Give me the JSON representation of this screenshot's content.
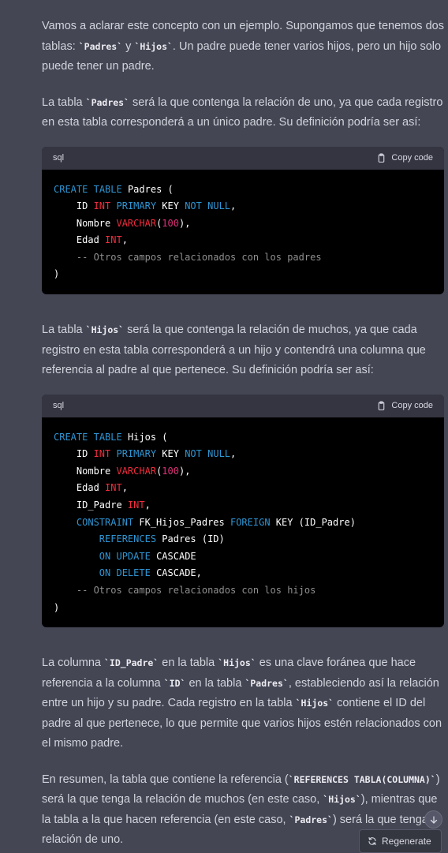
{
  "paragraphs": {
    "p1": [
      "Vamos a aclarar este concepto con un ejemplo. Supongamos que tenemos dos tablas: ",
      "`Padres`",
      " y ",
      "`Hijos`",
      ". Un padre puede tener varios hijos, pero un hijo solo puede tener un padre."
    ],
    "p2": [
      "La tabla ",
      "`Padres`",
      " será la que contenga la relación de uno, ya que cada registro en esta tabla corresponderá a un único padre. Su definición podría ser así:"
    ],
    "p3": [
      "La tabla ",
      "`Hijos`",
      " será la que contenga la relación de muchos, ya que cada registro en esta tabla corresponderá a un hijo y contendrá una columna que referencia al padre al que pertenece. Su definición podría ser así:"
    ],
    "p4": [
      "La columna ",
      "`ID_Padre`",
      " en la tabla ",
      "`Hijos`",
      " es una clave foránea que hace referencia a la columna ",
      "`ID`",
      " en la tabla ",
      "`Padres`",
      ", estableciendo así la relación entre un hijo y su padre. Cada registro en la tabla ",
      "`Hijos`",
      " contiene el ID del padre al que pertenece, lo que permite que varios hijos estén relacionados con el mismo padre."
    ],
    "p5": [
      "En resumen, la tabla que contiene la referencia (",
      "`REFERENCES TABLA(COLUMNA)`",
      ") será la que tenga la relación de muchos (en este caso, ",
      "`Hijos`",
      "), mientras que la tabla a la que hacen referencia (en este caso, ",
      "`Padres`",
      ") será la que tenga la relación de uno."
    ]
  },
  "code1": {
    "lang": "sql",
    "copy_label": "Copy code",
    "lines": [
      [
        [
          "kw",
          "CREATE"
        ],
        [
          "t",
          " "
        ],
        [
          "kw",
          "TABLE"
        ],
        [
          "t",
          " Padres ("
        ]
      ],
      [
        [
          "t",
          "    ID "
        ],
        [
          "ty",
          "INT"
        ],
        [
          "t",
          " "
        ],
        [
          "kw",
          "PRIMARY"
        ],
        [
          "t",
          " KEY "
        ],
        [
          "kw",
          "NOT"
        ],
        [
          "t",
          " "
        ],
        [
          "kw",
          "NULL"
        ],
        [
          "t",
          ","
        ]
      ],
      [
        [
          "t",
          "    Nombre "
        ],
        [
          "ty",
          "VARCHAR"
        ],
        [
          "t",
          "("
        ],
        [
          "nm",
          "100"
        ],
        [
          "t",
          "),"
        ]
      ],
      [
        [
          "t",
          "    Edad "
        ],
        [
          "ty",
          "INT"
        ],
        [
          "t",
          ","
        ]
      ],
      [
        [
          "cm",
          "    -- Otros campos relacionados con los padres"
        ]
      ],
      [
        [
          "t",
          ")"
        ]
      ]
    ]
  },
  "code2": {
    "lang": "sql",
    "copy_label": "Copy code",
    "lines": [
      [
        [
          "kw",
          "CREATE"
        ],
        [
          "t",
          " "
        ],
        [
          "kw",
          "TABLE"
        ],
        [
          "t",
          " Hijos ("
        ]
      ],
      [
        [
          "t",
          "    ID "
        ],
        [
          "ty",
          "INT"
        ],
        [
          "t",
          " "
        ],
        [
          "kw",
          "PRIMARY"
        ],
        [
          "t",
          " KEY "
        ],
        [
          "kw",
          "NOT"
        ],
        [
          "t",
          " "
        ],
        [
          "kw",
          "NULL"
        ],
        [
          "t",
          ","
        ]
      ],
      [
        [
          "t",
          "    Nombre "
        ],
        [
          "ty",
          "VARCHAR"
        ],
        [
          "t",
          "("
        ],
        [
          "nm",
          "100"
        ],
        [
          "t",
          "),"
        ]
      ],
      [
        [
          "t",
          "    Edad "
        ],
        [
          "ty",
          "INT"
        ],
        [
          "t",
          ","
        ]
      ],
      [
        [
          "t",
          "    ID_Padre "
        ],
        [
          "ty",
          "INT"
        ],
        [
          "t",
          ","
        ]
      ],
      [
        [
          "t",
          "    "
        ],
        [
          "kw",
          "CONSTRAINT"
        ],
        [
          "t",
          " FK_Hijos_Padres "
        ],
        [
          "kw",
          "FOREIGN"
        ],
        [
          "t",
          " KEY (ID_Padre)"
        ]
      ],
      [
        [
          "t",
          "        "
        ],
        [
          "kw",
          "REFERENCES"
        ],
        [
          "t",
          " Padres (ID)"
        ]
      ],
      [
        [
          "t",
          "        "
        ],
        [
          "kw",
          "ON"
        ],
        [
          "t",
          " "
        ],
        [
          "kw",
          "UPDATE"
        ],
        [
          "t",
          " CASCADE"
        ]
      ],
      [
        [
          "t",
          "        "
        ],
        [
          "kw",
          "ON"
        ],
        [
          "t",
          " "
        ],
        [
          "kw",
          "DELETE"
        ],
        [
          "t",
          " CASCADE,"
        ]
      ],
      [
        [
          "cm",
          "    -- Otros campos relacionados con los hijos"
        ]
      ],
      [
        [
          "t",
          ")"
        ]
      ]
    ]
  },
  "regenerate_label": "Regenerate",
  "colors": {
    "bg": "#444654",
    "code_bg": "#000000",
    "keyword": "#2e95d3",
    "type": "#f22c3d",
    "number": "#df3079",
    "comment": "#8f8f8f"
  }
}
